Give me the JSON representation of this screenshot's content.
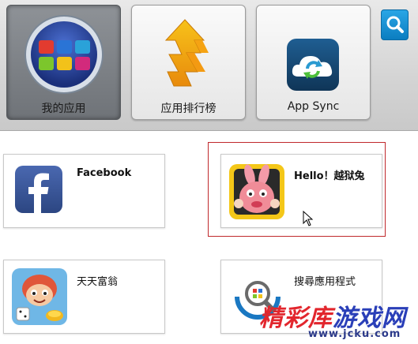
{
  "toolbar": {
    "tiles": [
      {
        "label": "我的应用",
        "icon": "my-apps-grid-icon",
        "active": true
      },
      {
        "label": "应用排行榜",
        "icon": "ranking-arrow-icon",
        "active": false
      },
      {
        "label": "App Sync",
        "icon": "app-sync-cloud-icon",
        "active": false
      }
    ],
    "search_icon": "search-icon"
  },
  "apps": [
    {
      "name": "Facebook",
      "icon": "facebook-icon"
    },
    {
      "name": "Hello！越狱兔",
      "icon": "escape-rabbit-icon"
    },
    {
      "name": "天天富翁",
      "icon": "rich-game-icon"
    },
    {
      "name": "搜尋應用程式",
      "icon": "app-search-icon"
    }
  ],
  "watermark": {
    "title_part1": "精彩库",
    "title_part2": "游戏网",
    "url": "www.jcku.com"
  },
  "colors": {
    "selection_frame": "#c0282c",
    "search_button": "#0b7dc0",
    "facebook_blue": "#3b5998"
  }
}
